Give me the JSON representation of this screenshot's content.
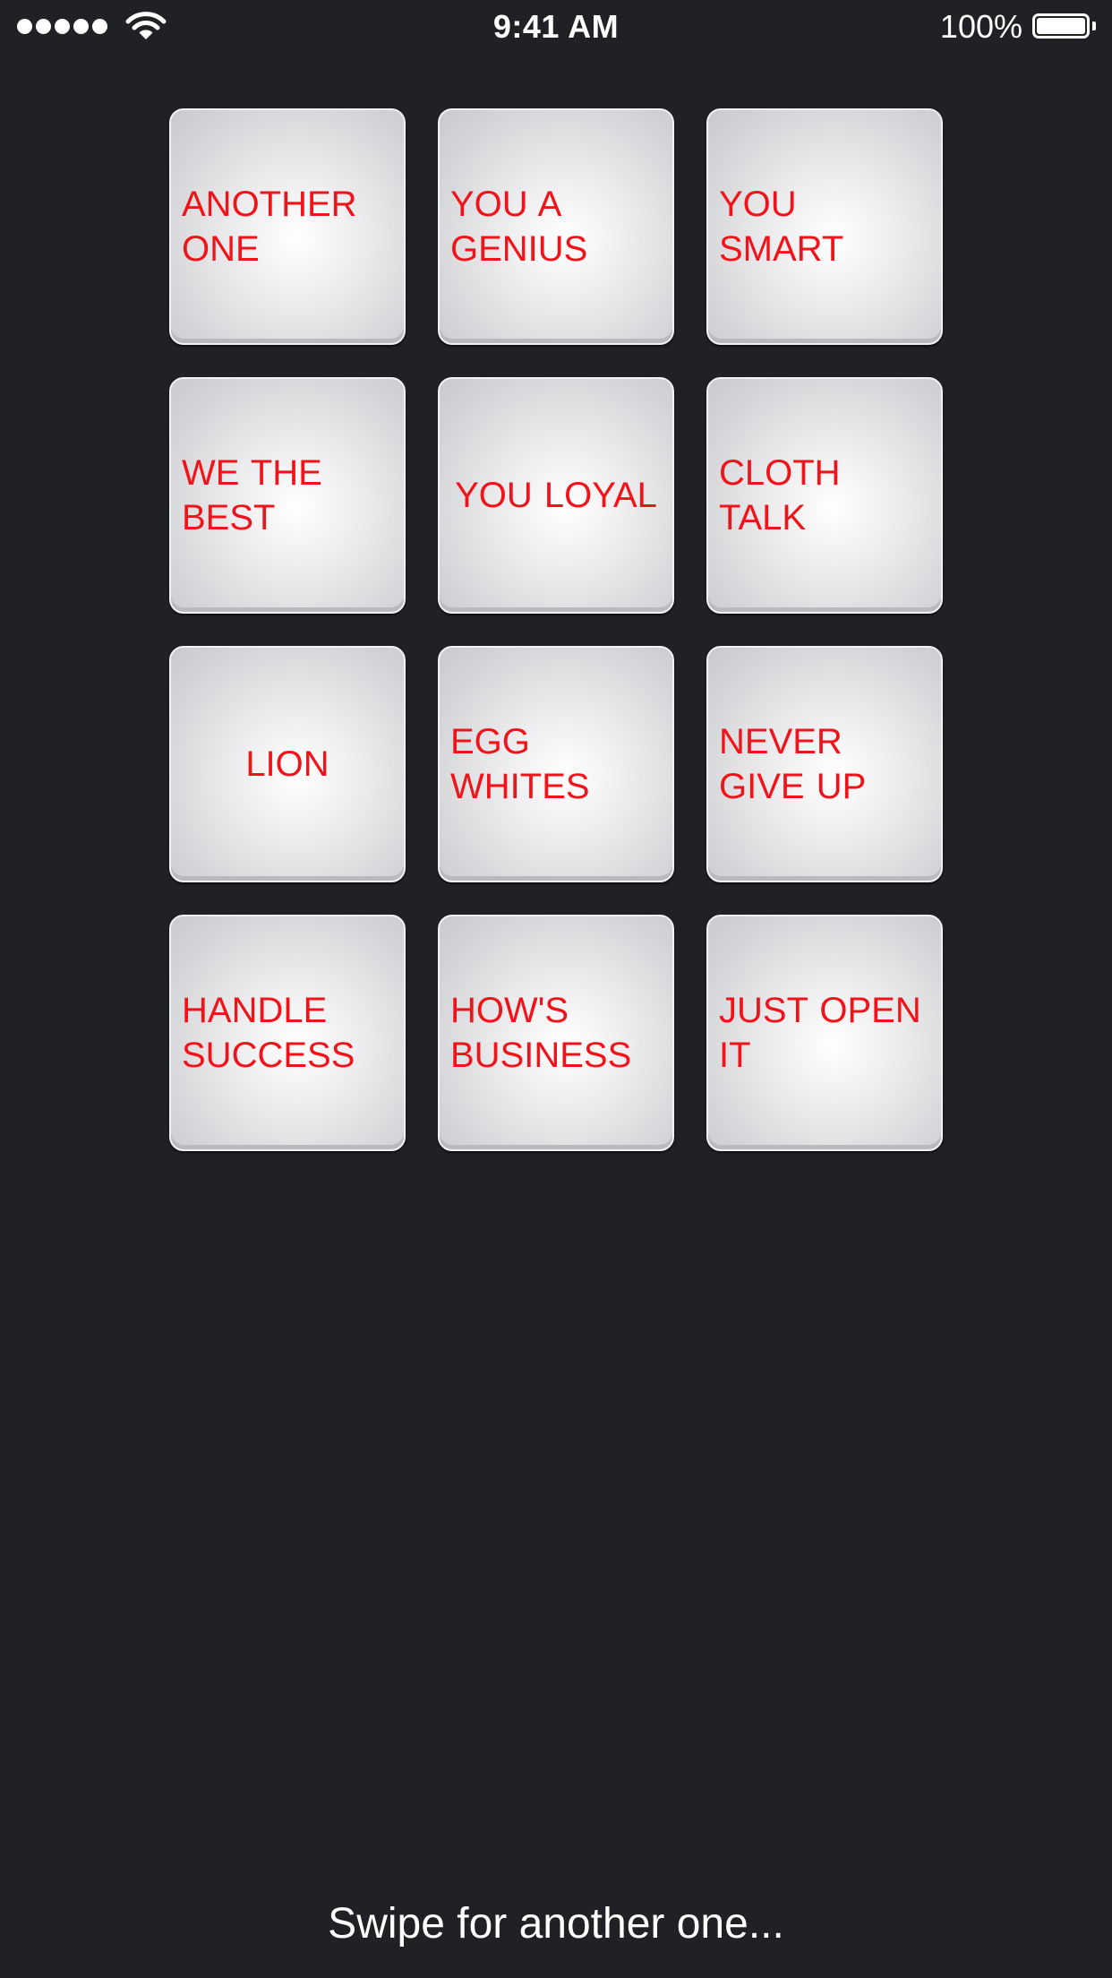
{
  "status_bar": {
    "time": "9:41 AM",
    "battery_percent": "100%",
    "signal_icon": "signal-dots-icon",
    "wifi_icon": "wifi-icon",
    "battery_icon": "battery-full-icon"
  },
  "soundboard": {
    "text_color": "#f0141a",
    "tiles": [
      {
        "label": "ANOTHER ONE"
      },
      {
        "label": "YOU A GENIUS"
      },
      {
        "label": "YOU SMART"
      },
      {
        "label": "WE THE BEST"
      },
      {
        "label": "YOU LOYAL"
      },
      {
        "label": "CLOTH TALK"
      },
      {
        "label": "LION"
      },
      {
        "label": "EGG WHITES"
      },
      {
        "label": "NEVER GIVE UP"
      },
      {
        "label": "HANDLE SUCCESS"
      },
      {
        "label": "HOW'S BUSINESS"
      },
      {
        "label": "JUST OPEN IT"
      }
    ]
  },
  "footer": {
    "hint": "Swipe for another one..."
  }
}
